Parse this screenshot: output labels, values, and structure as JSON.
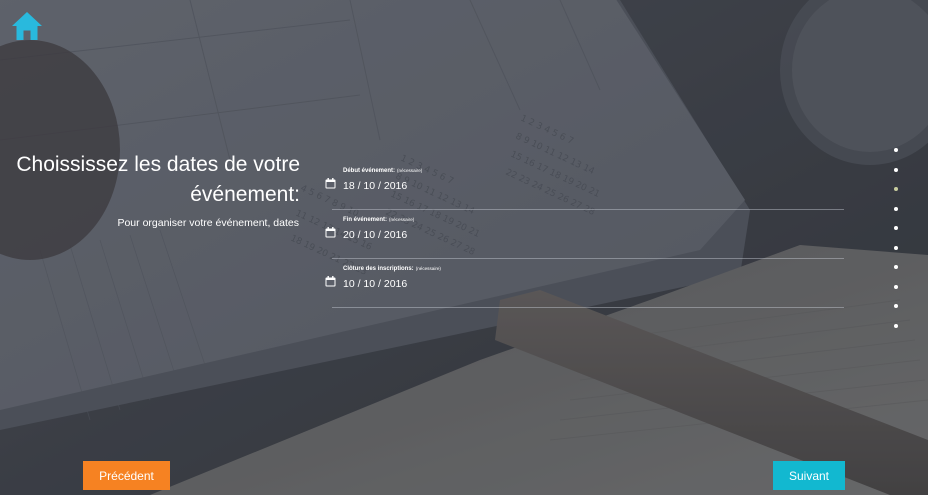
{
  "nav": {
    "home_icon": "home-icon",
    "home_color": "#29b9dd"
  },
  "header": {
    "title": "Choississez les dates de votre événement:",
    "subtitle": "Pour organiser votre événement, dates"
  },
  "fields": [
    {
      "label": "Début événement:",
      "required": "(nécessaire)",
      "value": "18 / 10 / 2016",
      "icon": "calendar-icon"
    },
    {
      "label": "Fin événement:",
      "required": "(nécessaire)",
      "value": "20 / 10 / 2016",
      "icon": "calendar-icon"
    },
    {
      "label": "Clôture des inscriptions:",
      "required": "(nécessaire)",
      "value": "10 / 10 / 2016",
      "icon": "calendar-icon"
    }
  ],
  "steps": {
    "count": 10,
    "active_index": 2
  },
  "buttons": {
    "previous": "Précédent",
    "next": "Suivant"
  },
  "colors": {
    "previous": "#f68222",
    "next": "#12b8d0",
    "accent": "#29b9dd"
  }
}
